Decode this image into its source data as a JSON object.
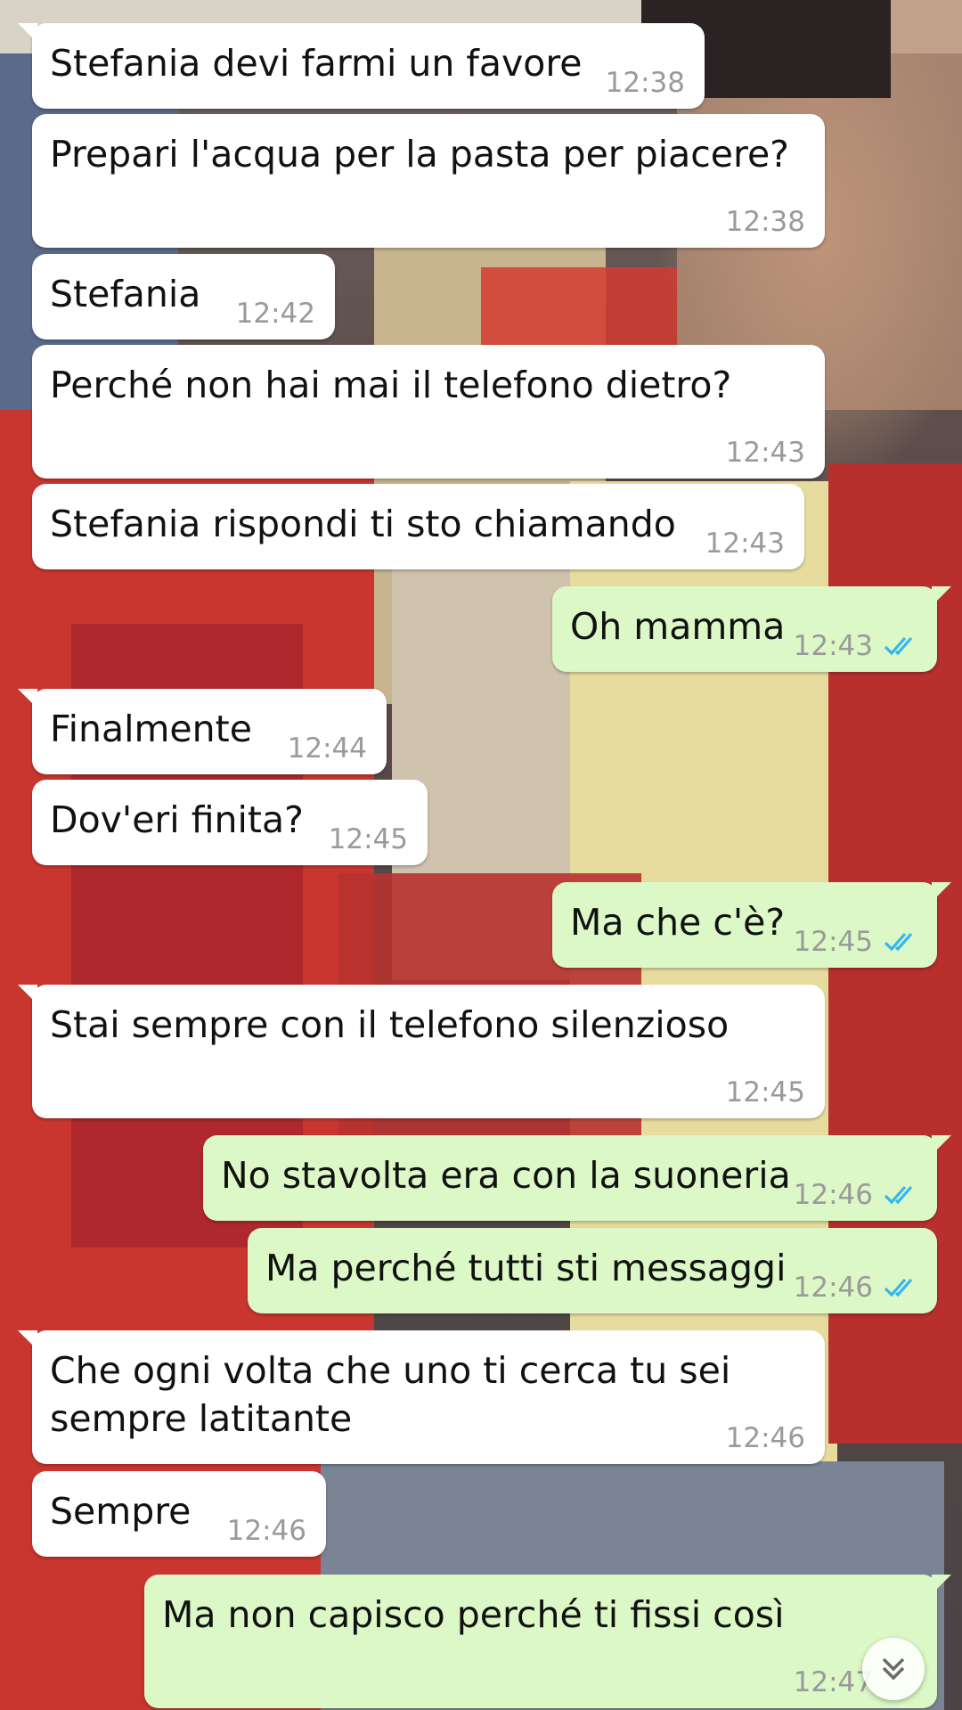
{
  "colors": {
    "incoming": "#ffffff",
    "outgoing": "#dcf8c6",
    "read_ticks": "#34b7f1",
    "time_text": "#9a9a9a"
  },
  "messages": [
    {
      "direction": "in",
      "text": "Stefania devi farmi un favore",
      "time": "12:38"
    },
    {
      "direction": "in",
      "text": "Prepari l'acqua per la pasta per piacere?",
      "time": "12:38"
    },
    {
      "direction": "in",
      "text": "Stefania",
      "time": "12:42"
    },
    {
      "direction": "in",
      "text": "Perché non hai mai il telefono dietro?",
      "time": "12:43"
    },
    {
      "direction": "in",
      "text": "Stefania rispondi ti sto chiamando",
      "time": "12:43"
    },
    {
      "direction": "out",
      "text": "Oh mamma",
      "time": "12:43",
      "status": "read"
    },
    {
      "direction": "in",
      "text": "Finalmente",
      "time": "12:44"
    },
    {
      "direction": "in",
      "text": "Dov'eri finita?",
      "time": "12:45"
    },
    {
      "direction": "out",
      "text": "Ma che c'è?",
      "time": "12:45",
      "status": "read"
    },
    {
      "direction": "in",
      "text": "Stai sempre con il telefono silenzioso",
      "time": "12:45"
    },
    {
      "direction": "out",
      "text": "No stavolta era con la suoneria",
      "time": "12:46",
      "status": "read"
    },
    {
      "direction": "out",
      "text": "Ma perché tutti sti messaggi",
      "time": "12:46",
      "status": "read"
    },
    {
      "direction": "in",
      "text": "Che ogni volta che uno ti cerca tu sei sempre latitante",
      "time": "12:46"
    },
    {
      "direction": "in",
      "text": "Sempre",
      "time": "12:46"
    },
    {
      "direction": "out",
      "text": "Ma non capisco perché ti fissi così",
      "time": "12:47"
    }
  ],
  "scroll_button": {
    "icon": "double-chevron-down-icon"
  }
}
